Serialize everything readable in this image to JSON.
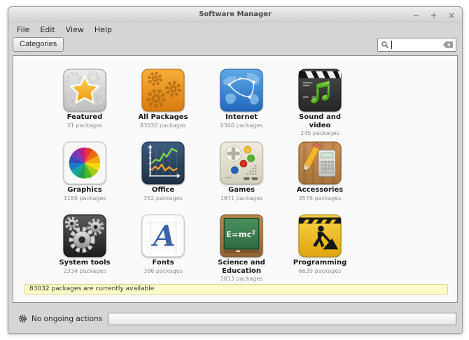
{
  "window": {
    "title": "Software Manager",
    "controls": {
      "minimize": "−",
      "maximize": "+",
      "close": "×"
    }
  },
  "menu": {
    "items": [
      "File",
      "Edit",
      "View",
      "Help"
    ]
  },
  "toolbar": {
    "categories_label": "Categories",
    "search": {
      "value": "",
      "placeholder": "",
      "icons": [
        "search-icon",
        "clear-icon"
      ]
    }
  },
  "categories": [
    {
      "label": "Featured",
      "count": "31 packages",
      "icon": "featured-icon"
    },
    {
      "label": "All Packages",
      "count": "83032 packages",
      "icon": "all-packages-icon"
    },
    {
      "label": "Internet",
      "count": "6360 packages",
      "icon": "internet-icon"
    },
    {
      "label": "Sound and video",
      "count": "245 packages",
      "icon": "sound-video-icon"
    },
    {
      "label": "Graphics",
      "count": "1189 packages",
      "icon": "graphics-icon"
    },
    {
      "label": "Office",
      "count": "352 packages",
      "icon": "office-icon"
    },
    {
      "label": "Games",
      "count": "1971 packages",
      "icon": "games-icon"
    },
    {
      "label": "Accessories",
      "count": "3576 packages",
      "icon": "accessories-icon"
    },
    {
      "label": "System tools",
      "count": "2334 packages",
      "icon": "system-tools-icon"
    },
    {
      "label": "Fonts",
      "count": "386 packages",
      "icon": "fonts-icon"
    },
    {
      "label": "Science and Education",
      "count": "2813 packages",
      "icon": "science-education-icon"
    },
    {
      "label": "Programming",
      "count": "6639 packages",
      "icon": "programming-icon"
    }
  ],
  "info_bar": {
    "text": "83032 packages are currently available"
  },
  "status_bar": {
    "text": "No ongoing actions",
    "icon": "gear-icon"
  },
  "colors": {
    "window_bg": "#d5d5d3",
    "content_bg": "#fafafa",
    "info_bar_bg": "#fcfcc9",
    "info_bar_border": "#dbd88e"
  }
}
